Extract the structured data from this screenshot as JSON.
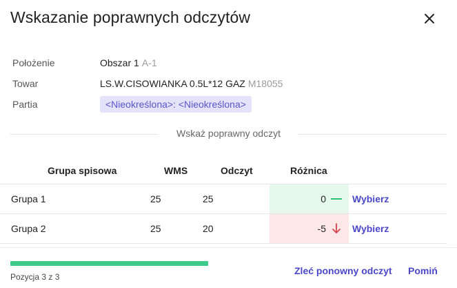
{
  "dialog": {
    "title": "Wskazanie poprawnych odczytów"
  },
  "info": {
    "location_label": "Położenie",
    "location_value": "Obszar 1",
    "location_code": "A-1",
    "product_label": "Towar",
    "product_value": "LS.W.CISOWIANKA 0.5L*12 GAZ",
    "product_code": "M18055",
    "batch_label": "Partia",
    "batch_value": "<Nieokreślona>: <Nieokreślona>"
  },
  "divider_text": "Wskaż poprawny odczyt",
  "table": {
    "headers": {
      "group": "Grupa spisowa",
      "wms": "WMS",
      "reading": "Odczyt",
      "difference": "Różnica"
    },
    "rows": [
      {
        "group": "Grupa 1",
        "wms": "25",
        "reading": "25",
        "difference": "0",
        "status": "equal",
        "action": "Wybierz"
      },
      {
        "group": "Grupa 2",
        "wms": "25",
        "reading": "20",
        "difference": "-5",
        "status": "down",
        "action": "Wybierz"
      }
    ]
  },
  "footer": {
    "progress_current": 3,
    "progress_total": 3,
    "position_text": "Pozycja 3 z 3",
    "reorder_button": "Zleć ponowny odczyt",
    "skip_button": "Pomiń"
  },
  "colors": {
    "accent": "#4a47c9",
    "progress": "#3dcc8c",
    "equal_bg": "#e6f8ec",
    "equal_icon": "#2fbf72",
    "down_bg": "#fde8e8",
    "down_icon": "#d9424c",
    "chip_bg": "#e4e3fb",
    "chip_text": "#5a55c8"
  },
  "icons": {
    "close": "close-icon",
    "equal": "dash-icon",
    "down": "arrow-down-icon"
  }
}
